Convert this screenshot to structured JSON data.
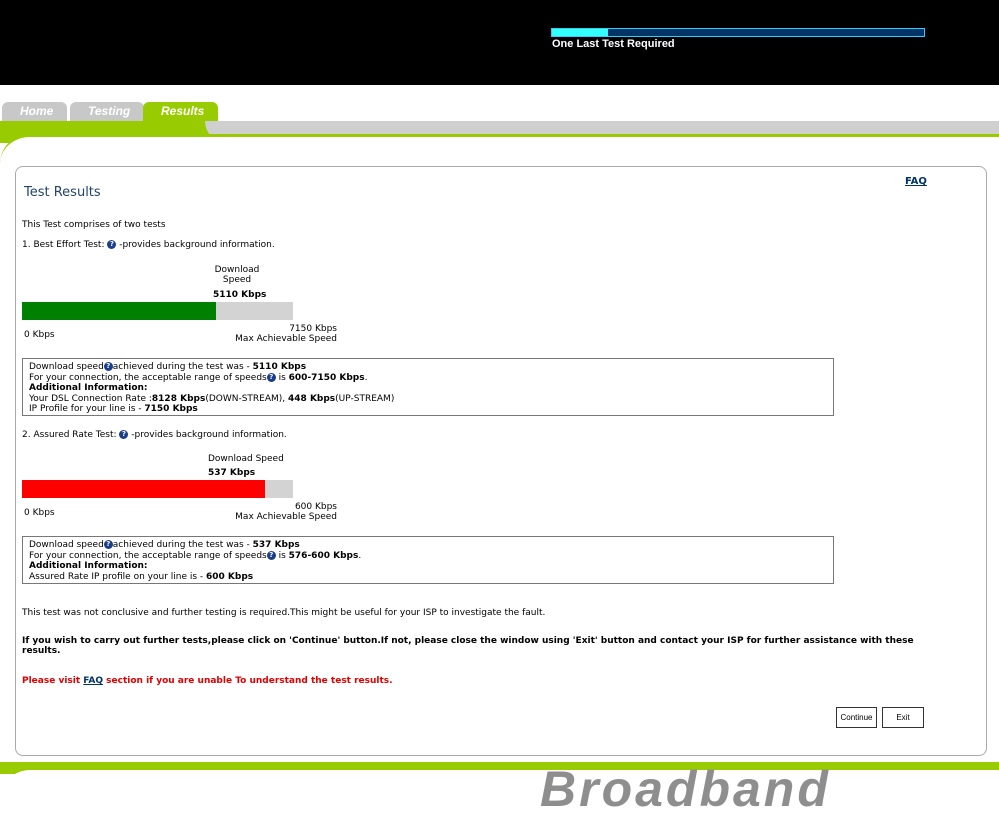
{
  "header": {
    "progress_label": "One Last Test Required",
    "progress_fraction": 0.15
  },
  "tabs": [
    {
      "label": "Home"
    },
    {
      "label": "Testing"
    },
    {
      "label": "Results"
    }
  ],
  "main": {
    "title": "Test Results",
    "faq_link": "FAQ",
    "intro": "This Test comprises of two tests",
    "test1": {
      "heading_prefix": "1. Best Effort Test: ",
      "heading_suffix": " -provides background information.",
      "speed_label_line1": "Download",
      "speed_label_line2": "Speed",
      "speed_value": "5110 Kbps",
      "min_label": "0 Kbps",
      "max_value": "7150 Kbps",
      "max_caption": "Max Achievable Speed",
      "fill_fraction": 0.7147,
      "fill_color": "#008000",
      "info": {
        "l1_a": "Download speed",
        "l1_b": "achieved during the test was - ",
        "l1_val": "5110 Kbps",
        "l2_a": "For your connection, the acceptable range of speeds",
        "l2_b": " is ",
        "l2_val": "600-7150 Kbps",
        "l2_end": ".",
        "l3": "Additional Information:",
        "l4_a": "Your DSL Connection Rate :",
        "l4_v1": "8128 Kbps",
        "l4_b": "(DOWN-STREAM), ",
        "l4_v2": "448 Kbps",
        "l4_c": "(UP-STREAM)",
        "l5_a": "IP Profile for your line is - ",
        "l5_val": "7150 Kbps"
      }
    },
    "test2": {
      "heading_prefix": "2. Assured Rate Test: ",
      "heading_suffix": " -provides background information.",
      "speed_label": "Download Speed",
      "speed_value": "537 Kbps",
      "min_label": "0 Kbps",
      "max_value": "600 Kbps",
      "max_caption": "Max Achievable Speed",
      "fill_fraction": 0.895,
      "fill_color": "#ff0000",
      "info": {
        "l1_a": "Download speed",
        "l1_b": "achieved during the test was - ",
        "l1_val": "537 Kbps",
        "l2_a": "For your connection, the acceptable range of speeds",
        "l2_b": " is ",
        "l2_val": "576-600 Kbps",
        "l2_end": ".",
        "l3": "Additional Information:",
        "l4_a": "Assured Rate IP profile on your line is - ",
        "l4_val": "600 Kbps"
      }
    },
    "conclusion": "This test was not conclusive and further testing is required.This might be useful for your ISP to investigate the fault.",
    "instruction": "If you wish to carry out further tests,please click on 'Continue' button.If not, please close the window using 'Exit' button and contact your ISP for further assistance with these results.",
    "visit_prefix": "Please visit ",
    "visit_link": "FAQ",
    "visit_suffix": " section if you are unable To understand the test results.",
    "continue_label": "Continue",
    "exit_label": "Exit"
  },
  "footer": {
    "brand": "Broadband"
  }
}
